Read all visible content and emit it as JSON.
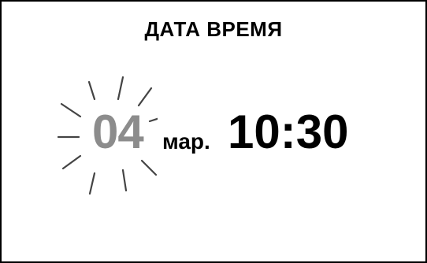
{
  "screen": {
    "title": "ДАТА ВРЕМЯ",
    "day": "04",
    "month": "мар.",
    "time": "10:30",
    "day_state": "blinking",
    "colors": {
      "border": "#000000",
      "text": "#000000",
      "active_field": "#8c8c8c"
    }
  }
}
